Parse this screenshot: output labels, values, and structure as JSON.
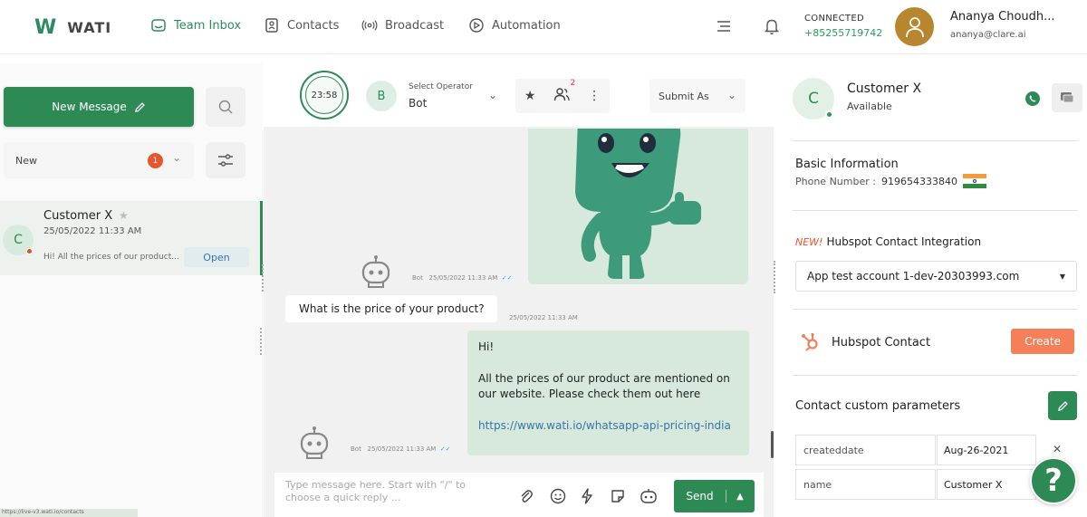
{
  "brand": {
    "name": "WATI"
  },
  "nav": {
    "items": [
      {
        "label": "Team Inbox",
        "icon": "inbox-icon",
        "active": true
      },
      {
        "label": "Contacts",
        "icon": "contacts-icon"
      },
      {
        "label": "Broadcast",
        "icon": "broadcast-icon"
      },
      {
        "label": "Automation",
        "icon": "automation-icon"
      }
    ]
  },
  "connection": {
    "status": "CONNECTED",
    "phone": "+85255719742"
  },
  "user": {
    "name": "Ananya Choudh...",
    "email": "ananya@clare.ai"
  },
  "sidebar": {
    "new_message_label": "New Message",
    "filter_label": "New",
    "filter_count": "1",
    "chats": [
      {
        "name": "Customer X",
        "avatar": "C",
        "date": "25/05/2022 11:33 AM",
        "preview": "Hi! All the prices of our product...",
        "status": "Open"
      }
    ],
    "status_bar_text": "https://live-v3.wati.io/contacts"
  },
  "chat": {
    "timer": "23:58",
    "operator": {
      "avatar": "B",
      "label": "Select Operator",
      "value": "Bot"
    },
    "participants_count": "2",
    "submit_label": "Submit As",
    "messages": [
      {
        "type": "image",
        "sender": "Bot",
        "time": "25/05/2022 11:33 AM"
      },
      {
        "type": "incoming",
        "text": "What is the price of your product?",
        "time": "25/05/2022 11:33 AM"
      },
      {
        "type": "outgoing",
        "greeting": "Hi!",
        "body": "All the prices of our product are mentioned on our website. Please check them out here",
        "link": "https://www.wati.io/whatsapp-api-pricing-india",
        "sender": "Bot",
        "time": "25/05/2022 11:33 AM"
      }
    ],
    "composer_placeholder": "Type message here. Start with \"/\" to choose a quick reply ...",
    "send_label": "Send"
  },
  "contact": {
    "avatar": "C",
    "name": "Customer X",
    "status": "Available",
    "basic_info_title": "Basic Information",
    "phone_label": "Phone Number :",
    "phone_value": "919654333840",
    "hubspot_new_tag": "NEW!",
    "hubspot_title": "Hubspot Contact Integration",
    "hubspot_account": "App test account 1-dev-20303993.com",
    "hubspot_contact_label": "Hubspot Contact",
    "create_label": "Create",
    "params_title": "Contact custom parameters",
    "params": [
      {
        "key": "createddate",
        "value": "Aug-26-2021"
      },
      {
        "key": "name",
        "value": "Customer X"
      }
    ]
  },
  "help_label": "?",
  "colors": {
    "brand_green": "#2e8a55",
    "accent_orange": "#f4805a",
    "badge_red": "#e8562b"
  }
}
